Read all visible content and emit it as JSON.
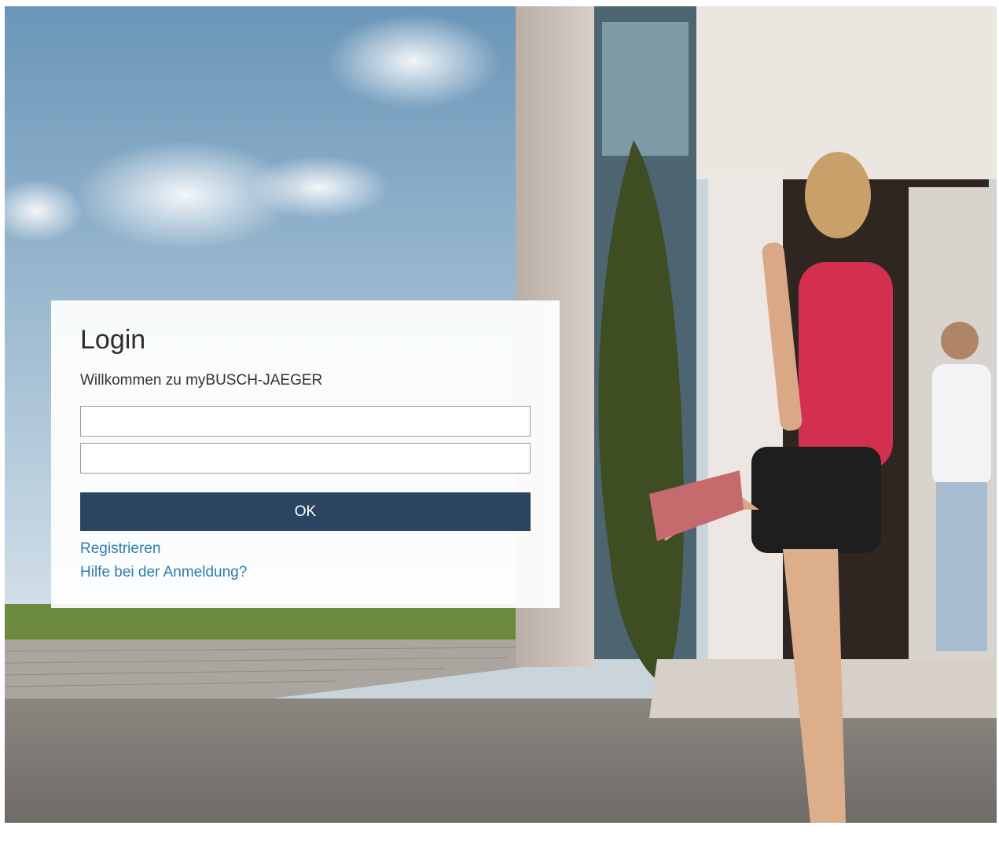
{
  "login": {
    "title": "Login",
    "welcome": "Willkommen zu myBUSCH-JAEGER",
    "username_value": "",
    "password_value": "",
    "ok_label": "OK",
    "register_link": "Registrieren",
    "help_link": "Hilfe bei der Anmeldung?"
  },
  "colors": {
    "button_bg": "#2b4560",
    "link": "#2e7cae"
  }
}
